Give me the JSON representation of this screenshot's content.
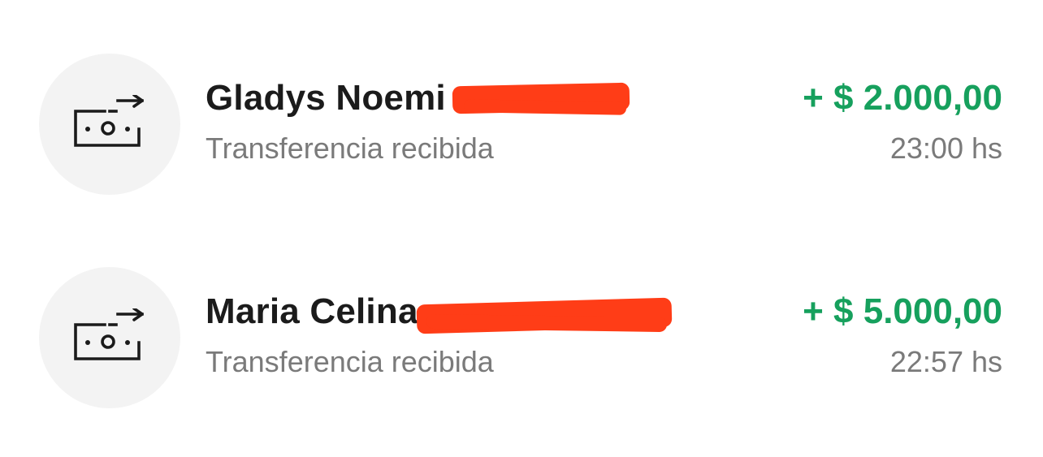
{
  "transactions": [
    {
      "name": "Gladys Noemi",
      "subtitle": "Transferencia recibida",
      "amount": "+ $ 2.000,00",
      "time": "23:00 hs",
      "icon": "money-transfer-icon",
      "amount_color": "#16a05d",
      "redaction_color": "#ff3d17"
    },
    {
      "name": "Maria Celina",
      "subtitle": "Transferencia recibida",
      "amount": "+ $ 5.000,00",
      "time": "22:57 hs",
      "icon": "money-transfer-icon",
      "amount_color": "#16a05d",
      "redaction_color": "#ff3d17"
    }
  ]
}
